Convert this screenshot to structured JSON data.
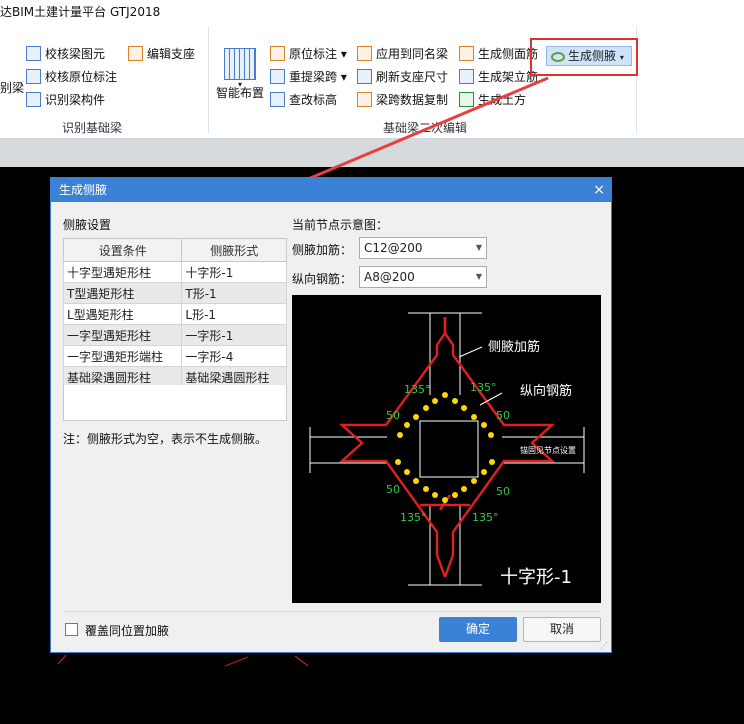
{
  "app": {
    "title": "达BIM土建计量平台 GTJ2018"
  },
  "ribbon": {
    "items_left": [
      "校核梁图元",
      "校核原位标注",
      "识别梁构件"
    ],
    "left_cut_label": "别梁",
    "edit_support": "编辑支座",
    "group1_label": "识别基础梁",
    "smart_layout": "智能布置",
    "items_mid": [
      "原位标注",
      "重提梁跨",
      "查改标高"
    ],
    "items_mid2": [
      "应用到同名梁",
      "刷新支座尺寸",
      "梁跨数据复制"
    ],
    "items_right": [
      "生成侧面筋",
      "生成架立筋",
      "生成土方"
    ],
    "generate_haunch": "生成侧腋",
    "group2_label": "基础梁二次编辑"
  },
  "dialog": {
    "title": "生成侧腋",
    "close": "×",
    "section_label": "侧腋设置",
    "columns": [
      "设置条件",
      "侧腋形式"
    ],
    "rows": [
      [
        "十字型遇矩形柱",
        "十字形-1"
      ],
      [
        "T型遇矩形柱",
        "T形-1"
      ],
      [
        "L型遇矩形柱",
        "L形-1"
      ],
      [
        "一字型遇矩形柱",
        "一字形-1"
      ],
      [
        "一字型遇矩形端柱",
        "一字形-4"
      ],
      [
        "基础梁遇圆形柱",
        "基础梁遇圆形柱"
      ]
    ],
    "note": "注：侧腋形式为空，表示不生成侧腋。",
    "preview_label": "当前节点示意图：",
    "haunch_rebar_label": "侧腋加筋：",
    "haunch_rebar_value": "C12@200",
    "long_rebar_label": "纵向钢筋：",
    "long_rebar_value": "A8@200",
    "diagram": {
      "haunch_rebar_callout": "侧腋加筋",
      "long_rebar_callout": "纵向钢筋",
      "angle": "135°",
      "dim": "50",
      "anchor_note": "锚固见节点设置",
      "shape_name": "十字形-1"
    },
    "overlay_checkbox": "覆盖同位置加腋",
    "ok": "确定",
    "cancel": "取消"
  },
  "colors": {
    "accent": "#3b82d6",
    "highlight": "#e03030",
    "rebar": "#e02020",
    "bar": "#ffd700",
    "dim": "#2ecc40"
  }
}
